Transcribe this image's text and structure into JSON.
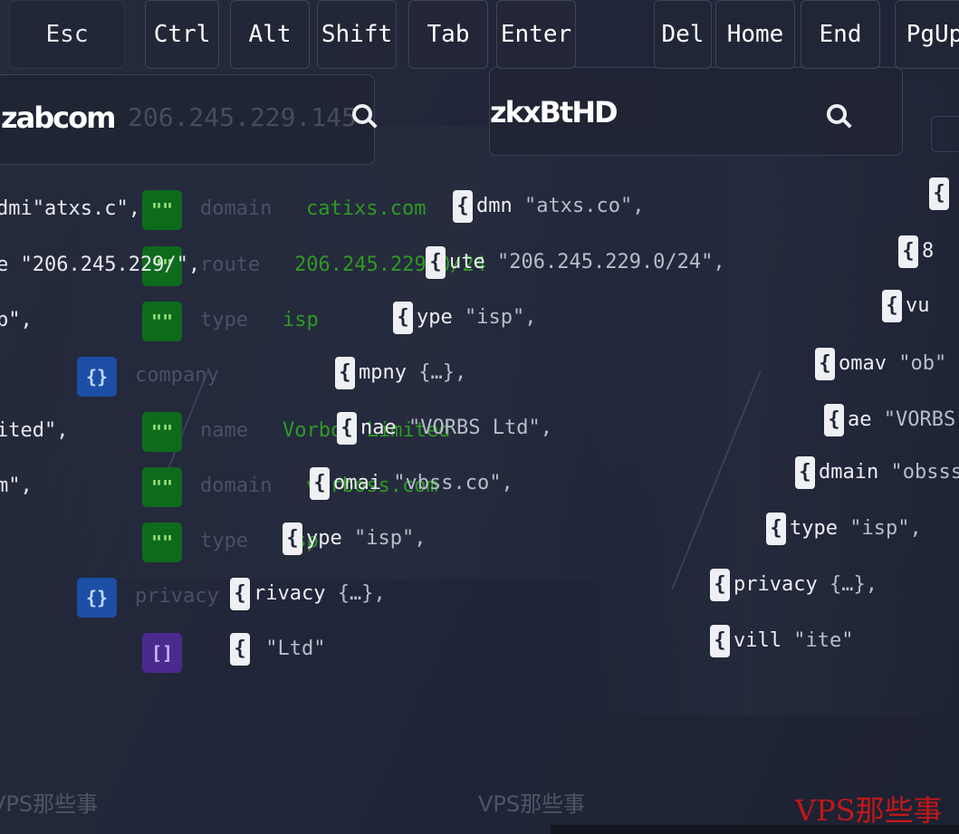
{
  "search_left": {
    "query": "206.245.229.145",
    "overlay": "zabcom"
  },
  "search_right": {
    "query": "zkxBtHD"
  },
  "left_panel": {
    "rows": [
      {
        "badge": "\"\"",
        "key": "domain",
        "value": "catixs.com",
        "trail": "dmi\"atxs.c\","
      },
      {
        "badge": "\"\"",
        "key": "route",
        "value": "206.245.229.0/24",
        "trail": "e \"206.245.229/\","
      },
      {
        "badge": "\"\"",
        "key": "type",
        "value": "isp",
        "trail": "p\","
      },
      {
        "badge": "{}",
        "key": "company",
        "value": "",
        "trail": ""
      },
      {
        "badge": "\"\"",
        "key": "name",
        "value": "VorboS Limited",
        "trail": "ited\","
      },
      {
        "badge": "\"\"",
        "key": "domain",
        "value": "vorboss.com",
        "trail": "m\","
      },
      {
        "badge": "\"\"",
        "key": "type",
        "value": "isp",
        "trail": ""
      },
      {
        "badge": "{}",
        "key": "privacy",
        "value": "",
        "trail": ""
      },
      {
        "badge": "[]",
        "key": "",
        "value": "",
        "trail": ""
      }
    ]
  },
  "chips_middle": [
    {
      "key": "dmn",
      "val": "\"atxs.co\","
    },
    {
      "key": "ute",
      "val": "\"206.245.229.0/24\","
    },
    {
      "key": "ype",
      "val": "\"isp\","
    },
    {
      "key": "mpny",
      "val": "{…},"
    },
    {
      "key": "nae",
      "val": "\"VORBS Ltd\","
    },
    {
      "key": "omai",
      "val": "\"vbss.co\","
    },
    {
      "key": "ype",
      "val": "\"isp\","
    },
    {
      "key": "rivacy",
      "val": "{…},"
    },
    {
      "key": "",
      "val": "\"Ltd\""
    }
  ],
  "chips_right": [
    {
      "key": "",
      "val": ""
    },
    {
      "key": "8",
      "val": ""
    },
    {
      "key": "vu",
      "val": ""
    },
    {
      "key": "omav",
      "val": "\"ob\""
    },
    {
      "key": "ae",
      "val": "\"VORBS\""
    },
    {
      "key": "dmain",
      "val": "\"obsss\""
    },
    {
      "key": "type",
      "val": "\"isp\","
    },
    {
      "key": "privacy",
      "val": "{…},"
    },
    {
      "key": "vill",
      "val": "\"ite\""
    }
  ],
  "keys_left": [
    "Esc",
    "Ctrl",
    "Alt",
    "Shift",
    "Tab",
    "Enter"
  ],
  "keys_right": [
    "Del",
    "Home",
    "End",
    "PgUp"
  ],
  "footer": {
    "left": "VPS那些事",
    "middle": "VPS那些事",
    "watermark": "VPS那些事"
  }
}
